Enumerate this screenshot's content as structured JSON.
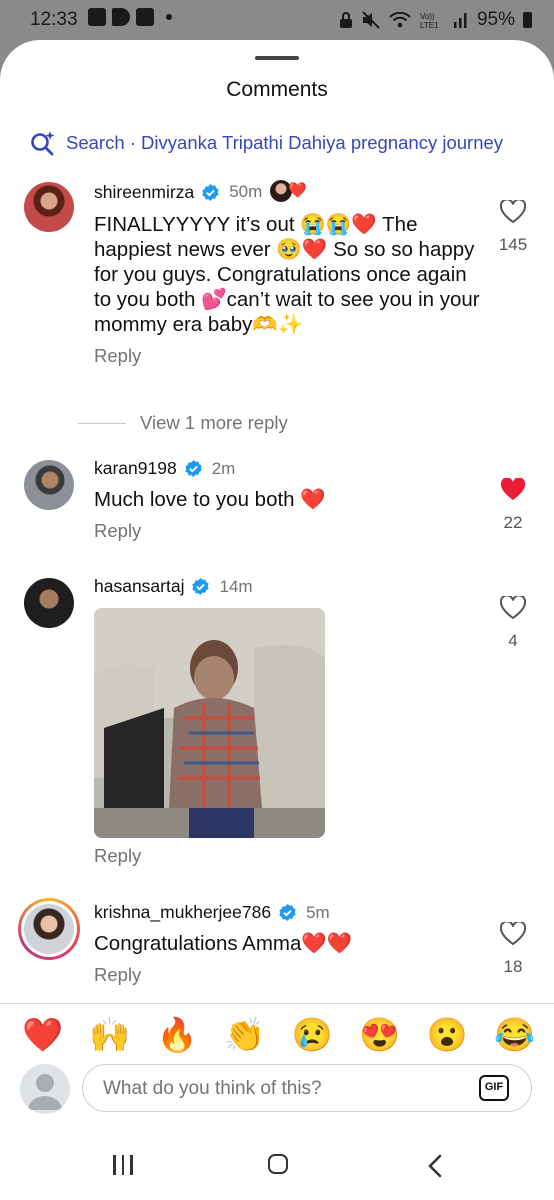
{
  "status_bar": {
    "time": "12:33",
    "battery": "95%"
  },
  "sheet": {
    "title": "Comments",
    "search_text": "Search · Divyanka Tripathi Dahiya pregnancy journey"
  },
  "comments": [
    {
      "username": "shireenmirza",
      "time": "50m",
      "text": "FINALLYYYYY it’s out 😭😭❤️ The happiest news ever 🥹❤️ So so so happy for you guys. Congratulations once again to you both 💕can’t wait to see you in your mommy era baby🫶✨",
      "reply": "Reply",
      "likes": "145",
      "liked": false
    },
    {
      "username": "karan9198",
      "time": "2m",
      "text": "Much love to you both ❤️",
      "reply": "Reply",
      "likes": "22",
      "liked": true
    },
    {
      "username": "hasansartaj",
      "time": "14m",
      "reply": "Reply",
      "likes": "4",
      "liked": false
    },
    {
      "username": "krishna_mukherjee786",
      "time": "5m",
      "text": "Congratulations Amma❤️❤️",
      "reply": "Reply",
      "likes": "18",
      "liked": false
    }
  ],
  "view_more_replies": "View 1 more reply",
  "quick_emojis": [
    "❤️",
    "🙌",
    "🔥",
    "👏",
    "😢",
    "😍",
    "😮",
    "😂"
  ],
  "composer": {
    "placeholder": "What do you think of this?",
    "gif_label": "GIF"
  },
  "colors": {
    "accent": "#3847b8",
    "verified": "#1d9bf0",
    "like_red": "#ed1c35"
  }
}
